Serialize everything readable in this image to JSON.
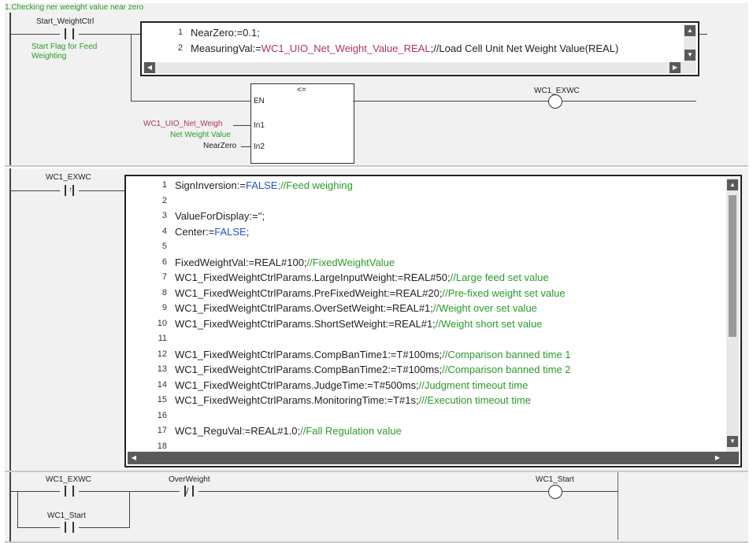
{
  "rung1": {
    "title": "1.Checking ner weeight value near zero",
    "contact_var": "Start_WeightCtrl",
    "contact_comment": "Start Flag for Feed Weighting",
    "st_lines": [
      {
        "n": "1",
        "segs": [
          {
            "t": "NearZero:=0.1;",
            "c": "plain"
          }
        ]
      },
      {
        "n": "2",
        "segs": [
          {
            "t": "MeasuringVal:=",
            "c": "plain"
          },
          {
            "t": "WC1_UIO_Net_Weight_Value_REAL",
            "c": "var"
          },
          {
            "t": ";//Load Cell Unit Net Weight Value(REAL)",
            "c": "plain"
          }
        ]
      }
    ],
    "fb_title": "<=",
    "fb_en": "EN",
    "fb_in1": "In1",
    "fb_in2": "In2",
    "in1_var": "WC1_UIO_Net_Weigh",
    "in1_comment": "Net Weight Value",
    "in2_var": "NearZero",
    "coil_var": "WC1_EXWC"
  },
  "rung2": {
    "contact_var": "WC1_EXWC",
    "st_lines": [
      {
        "n": "1",
        "segs": [
          {
            "t": "SignInversion:=",
            "c": "plain"
          },
          {
            "t": "FALSE",
            "c": "kw"
          },
          {
            "t": ";//Feed weighing",
            "c": "com"
          }
        ]
      },
      {
        "n": "2",
        "segs": []
      },
      {
        "n": "3",
        "segs": [
          {
            "t": "ValueForDisplay:='';",
            "c": "plain"
          }
        ]
      },
      {
        "n": "4",
        "segs": [
          {
            "t": "Center:=",
            "c": "plain"
          },
          {
            "t": "FALSE",
            "c": "kw"
          },
          {
            "t": ";",
            "c": "plain"
          }
        ]
      },
      {
        "n": "5",
        "segs": []
      },
      {
        "n": "6",
        "segs": [
          {
            "t": "FixedWeightVal:=REAL#100;",
            "c": "plain"
          },
          {
            "t": "//FixedWeightValue",
            "c": "com"
          }
        ]
      },
      {
        "n": "7",
        "segs": [
          {
            "t": "WC1_FixedWeightCtrlParams.LargeInputWeight:=REAL#50;",
            "c": "plain"
          },
          {
            "t": "//Large feed set value",
            "c": "com"
          }
        ]
      },
      {
        "n": "8",
        "segs": [
          {
            "t": "WC1_FixedWeightCtrlParams.PreFixedWeight:=REAL#20;",
            "c": "plain"
          },
          {
            "t": "//Pre-fixed weight set value",
            "c": "com"
          }
        ]
      },
      {
        "n": "9",
        "segs": [
          {
            "t": "WC1_FixedWeightCtrlParams.OverSetWeight:=REAL#1;",
            "c": "plain"
          },
          {
            "t": "//Weight over set value",
            "c": "com"
          }
        ]
      },
      {
        "n": "10",
        "segs": [
          {
            "t": "WC1_FixedWeightCtrlParams.ShortSetWeight:=REAL#1;",
            "c": "plain"
          },
          {
            "t": "//Weight short set value",
            "c": "com"
          }
        ]
      },
      {
        "n": "11",
        "segs": []
      },
      {
        "n": "12",
        "segs": [
          {
            "t": "WC1_FixedWeightCtrlParams.CompBanTime1:=T#100ms;",
            "c": "plain"
          },
          {
            "t": "//Comparison banned time 1",
            "c": "com"
          }
        ]
      },
      {
        "n": "13",
        "segs": [
          {
            "t": "WC1_FixedWeightCtrlParams.CompBanTime2:=T#100ms;",
            "c": "plain"
          },
          {
            "t": "//Comparison banned time 2",
            "c": "com"
          }
        ]
      },
      {
        "n": "14",
        "segs": [
          {
            "t": "WC1_FixedWeightCtrlParams.JudgeTime:=T#500ms;",
            "c": "plain"
          },
          {
            "t": "//Judgment timeout time",
            "c": "com"
          }
        ]
      },
      {
        "n": "15",
        "segs": [
          {
            "t": "WC1_FixedWeightCtrlParams.MonitoringTime:=T#1s;",
            "c": "plain"
          },
          {
            "t": "///Execution timeout time",
            "c": "com"
          }
        ]
      },
      {
        "n": "16",
        "segs": []
      },
      {
        "n": "17",
        "segs": [
          {
            "t": "WC1_ReguVal:=REAL#1.0;",
            "c": "plain"
          },
          {
            "t": "//Fall Regulation value",
            "c": "com"
          }
        ]
      },
      {
        "n": "18",
        "segs": []
      }
    ]
  },
  "rung3": {
    "contact1_var": "WC1_EXWC",
    "contact2_var": "OverWeight",
    "contact3_var": "WC1_Start",
    "coil_var": "WC1_Start"
  },
  "colors": {
    "keyword": "#2255cc",
    "variable": "#b0306a",
    "comment": "#2a9a2a"
  }
}
